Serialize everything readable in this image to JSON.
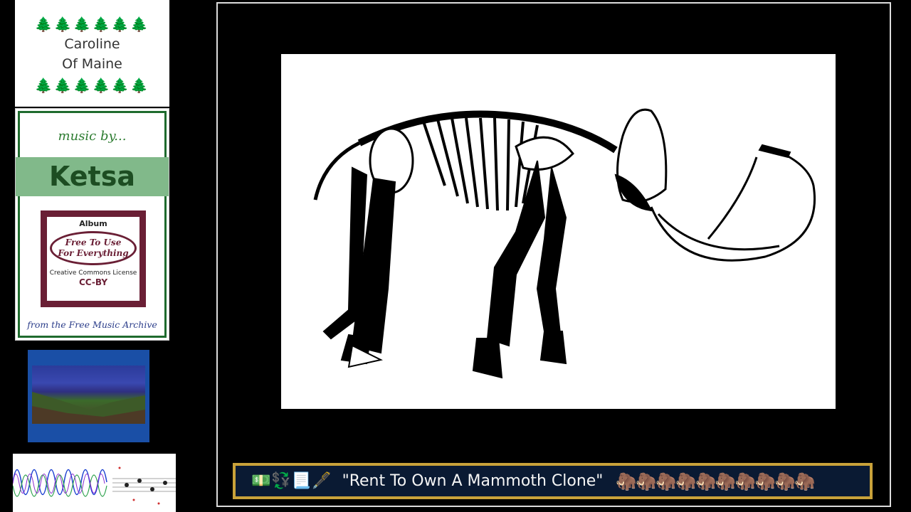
{
  "title_card": {
    "trees": "🌲🌲🌲🌲🌲🌲",
    "line1": "Caroline",
    "line2": "Of Maine"
  },
  "credit_card": {
    "music_by": "music by...",
    "artist": "Ketsa",
    "album_label": "Album",
    "album_title_line1": "Free To Use",
    "album_title_line2": "For Everything",
    "license_line": "Creative Commons License",
    "license_code": "CC-BY",
    "source": "from the Free Music Archive"
  },
  "caption": {
    "icons": "💵💱📃🖋️",
    "title": "\"Rent To Own A Mammoth Clone\"",
    "mammoths": "🦣🦣🦣🦣🦣🦣🦣🦣🦣🦣"
  },
  "colors": {
    "background": "#000000",
    "tree_green": "#1e7a2a",
    "artist_band": "#81b98a",
    "album_maroon": "#6a1f35",
    "caption_bg": "#0a1a33",
    "caption_border": "#c9a23a"
  }
}
